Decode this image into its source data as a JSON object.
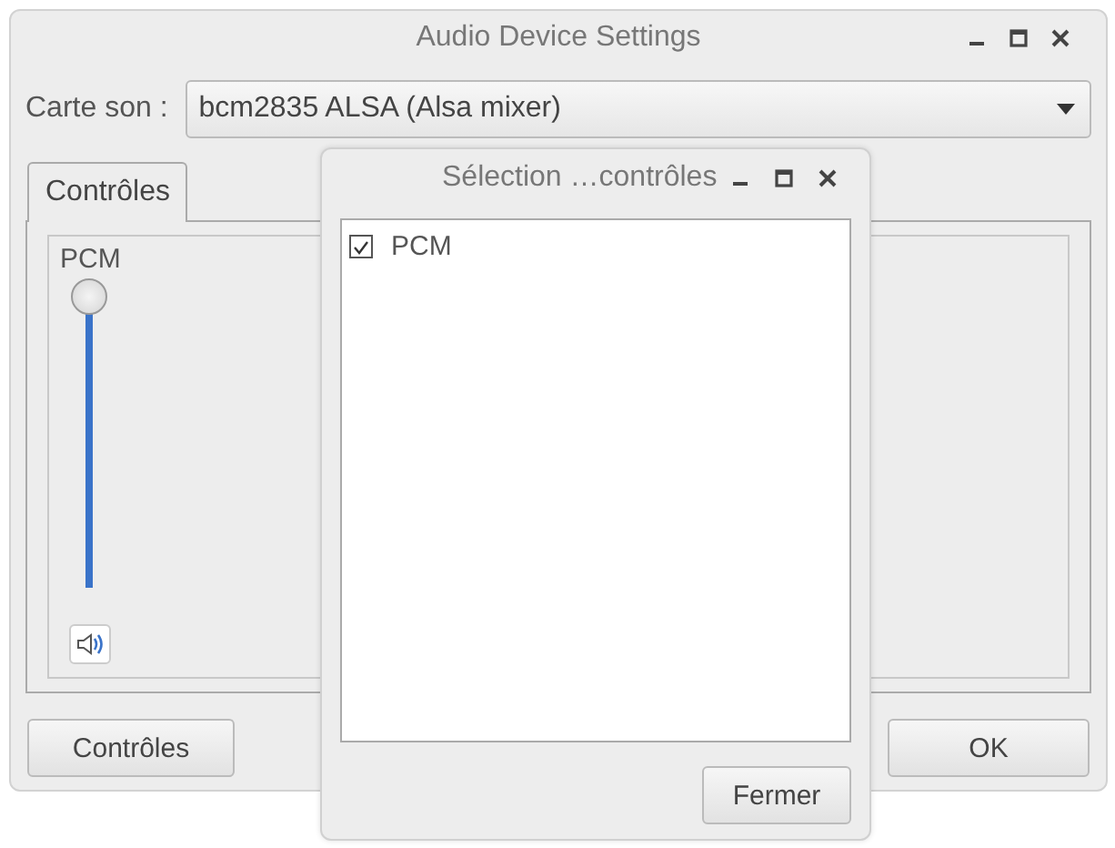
{
  "window": {
    "title": "Audio Device Settings"
  },
  "sound_card": {
    "label": "Carte son :",
    "value": "bcm2835 ALSA (Alsa mixer)"
  },
  "tabs": [
    {
      "label": "Contrôles",
      "selected": true
    }
  ],
  "channels": [
    {
      "name": "PCM",
      "level": 1.0,
      "muted": false
    }
  ],
  "buttons": [
    "Contrôles",
    "OK"
  ],
  "dialog": {
    "title": "Sélection …contrôles",
    "items": [
      {
        "label": "PCM",
        "checked": true
      }
    ],
    "buttons": [
      "Fermer"
    ]
  }
}
